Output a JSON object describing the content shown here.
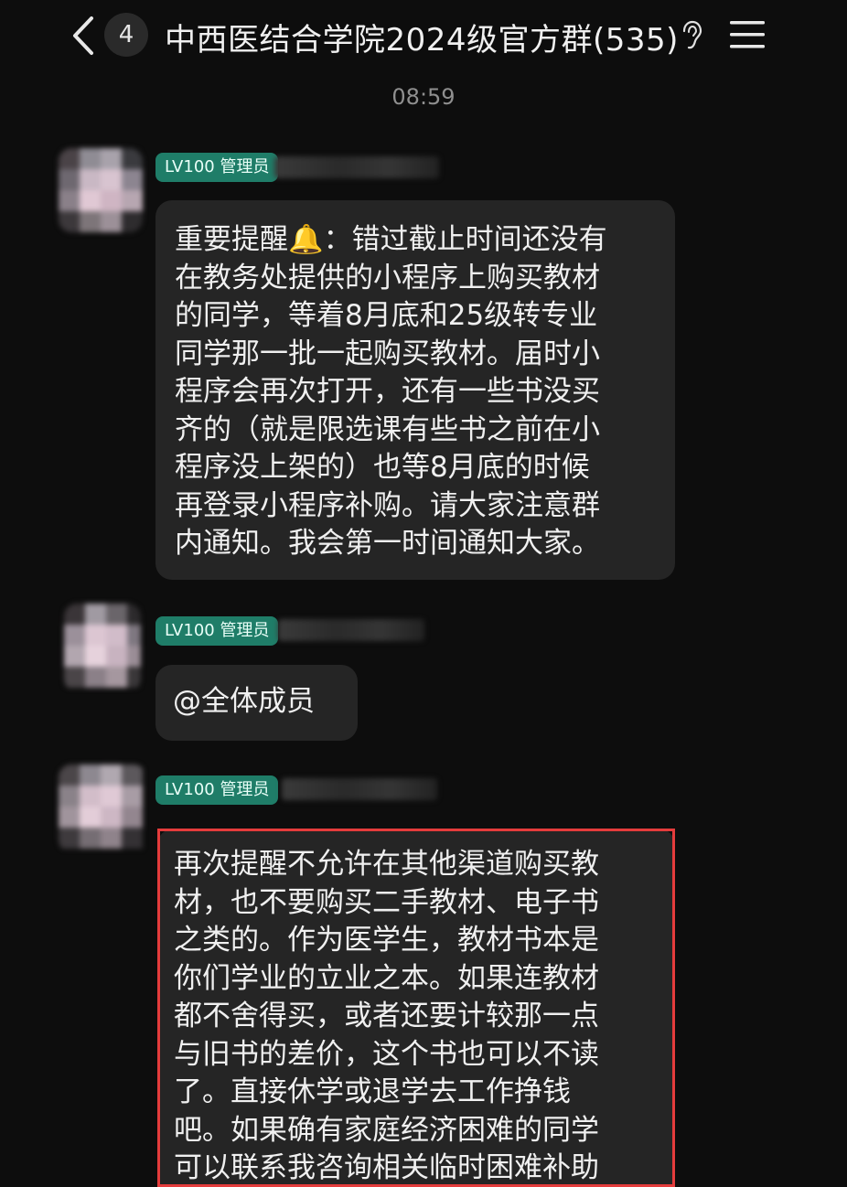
{
  "header": {
    "unread_count": "4",
    "title": "中西医结合学院2024级官方群(535)"
  },
  "timestamp": "08:59",
  "messages": [
    {
      "role_badge": "LV100 管理员",
      "text": "重要提醒🔔：错过截止时间还没有\n在教务处提供的小程序上购买教材\n的同学，等着8月底和25级转专业\n同学那一批一起购买教材。届时小\n程序会再次打开，还有一些书没买\n齐的（就是限选课有些书之前在小\n程序没上架的）也等8月底的时候\n再登录小程序补购。请大家注意群\n内通知。我会第一时间通知大家。"
    },
    {
      "role_badge": "LV100 管理员",
      "text": "@全体成员"
    },
    {
      "role_badge": "LV100 管理员",
      "text": "再次提醒不允许在其他渠道购买教\n材，也不要购买二手教材、电子书\n之类的。作为医学生，教材书本是\n你们学业的立业之本。如果连教材\n都不舍得买，或者还要计较那一点\n与旧书的差价，这个书也可以不读\n了。直接休学或退学去工作挣钱\n吧。如果确有家庭经济困难的同学\n可以联系我咨询相关临时困难补助"
    }
  ],
  "colors": {
    "background": "#0d0d0d",
    "bubble": "#252525",
    "badge": "#1f7d68",
    "highlight": "#e43c3c"
  },
  "icons": [
    "back-arrow-icon",
    "ear-icon",
    "menu-icon"
  ]
}
